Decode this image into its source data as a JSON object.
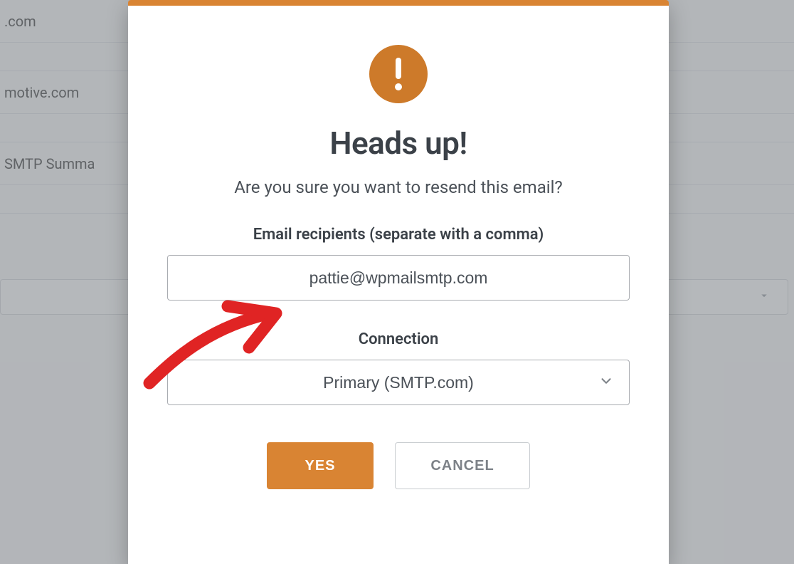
{
  "background": {
    "rows": [
      ".com",
      "",
      "motive.com",
      "",
      "SMTP Summa"
    ]
  },
  "modal": {
    "title": "Heads up!",
    "subtitle": "Are you sure you want to resend this email?",
    "recipients": {
      "label": "Email recipients (separate with a comma)",
      "value": "pattie@wpmailsmtp.com"
    },
    "connection": {
      "label": "Connection",
      "selected": "Primary (SMTP.com)"
    },
    "buttons": {
      "yes": "YES",
      "cancel": "CANCEL"
    }
  },
  "colors": {
    "accent": "#d98433",
    "iconFill": "#cd7a2a",
    "textDark": "#3b4148",
    "textMid": "#4b5158",
    "border": "#a9acb1"
  }
}
